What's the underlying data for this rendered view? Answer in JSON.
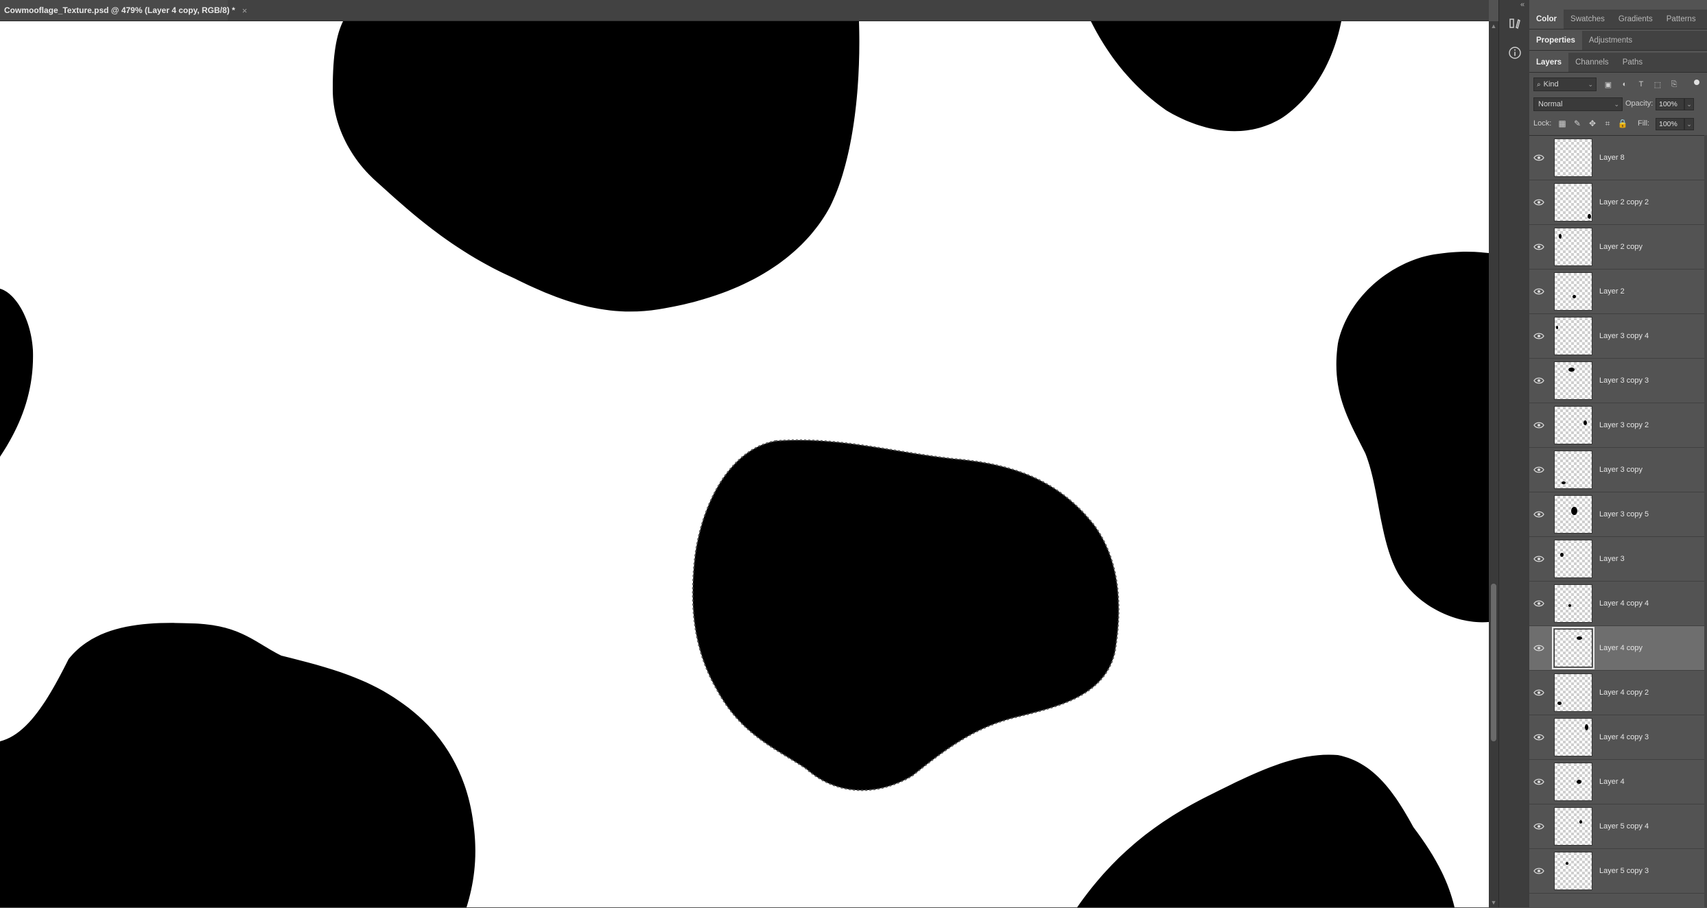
{
  "document": {
    "tab_title": "Cowmooflage_Texture.psd @ 479% (Layer 4 copy, RGB/8) *",
    "close_symbol": "×"
  },
  "panel_tabs_top": [
    {
      "label": "Color",
      "active": true
    },
    {
      "label": "Swatches",
      "active": false
    },
    {
      "label": "Gradients",
      "active": false
    },
    {
      "label": "Patterns",
      "active": false
    }
  ],
  "panel_tabs_mid": [
    {
      "label": "Properties",
      "active": true
    },
    {
      "label": "Adjustments",
      "active": false
    }
  ],
  "panel_tabs_layers": [
    {
      "label": "Layers",
      "active": true
    },
    {
      "label": "Channels",
      "active": false
    },
    {
      "label": "Paths",
      "active": false
    }
  ],
  "layers_panel": {
    "filter_kind": "Kind",
    "blend_mode": "Normal",
    "opacity_label": "Opacity:",
    "opacity_value": "100%",
    "lock_label": "Lock:",
    "fill_label": "Fill:",
    "fill_value": "100%"
  },
  "layers": [
    {
      "name": "Layer 8",
      "selected": false
    },
    {
      "name": "Layer 2 copy 2",
      "selected": false
    },
    {
      "name": "Layer 2 copy",
      "selected": false
    },
    {
      "name": "Layer 2",
      "selected": false
    },
    {
      "name": "Layer 3 copy 4",
      "selected": false
    },
    {
      "name": "Layer 3 copy 3",
      "selected": false
    },
    {
      "name": "Layer 3 copy 2",
      "selected": false
    },
    {
      "name": "Layer 3 copy",
      "selected": false
    },
    {
      "name": "Layer 3 copy 5",
      "selected": false
    },
    {
      "name": "Layer 3",
      "selected": false
    },
    {
      "name": "Layer 4 copy 4",
      "selected": false
    },
    {
      "name": "Layer 4 copy",
      "selected": true
    },
    {
      "name": "Layer 4 copy 2",
      "selected": false
    },
    {
      "name": "Layer 4 copy 3",
      "selected": false
    },
    {
      "name": "Layer 4",
      "selected": false
    },
    {
      "name": "Layer 5 copy 4",
      "selected": false
    },
    {
      "name": "Layer 5 copy 3",
      "selected": false
    }
  ],
  "colors": {
    "app_bg": "#535353",
    "canvas": "#ffffff",
    "spot": "#000000",
    "selected_layer": "#6e6e6e"
  }
}
